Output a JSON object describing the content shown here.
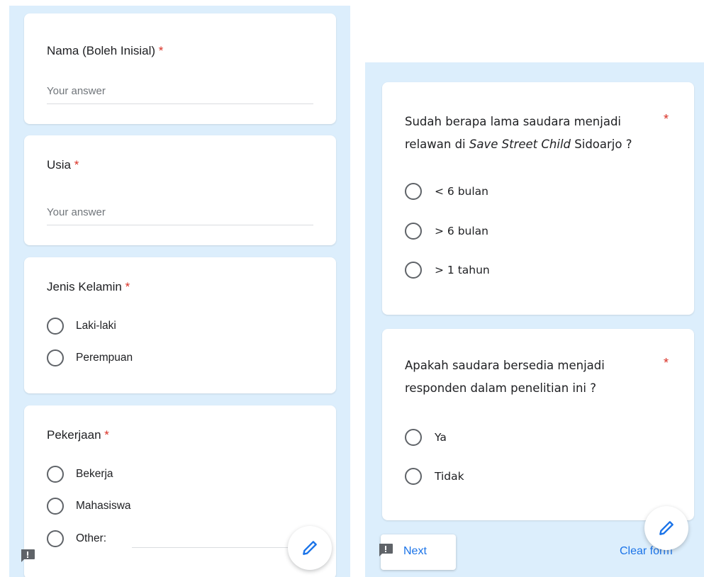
{
  "left_form": {
    "name_question": {
      "title": "Nama (Boleh Inisial)",
      "required_mark": "*",
      "placeholder": "Your answer"
    },
    "age_question": {
      "title": "Usia",
      "required_mark": "*",
      "placeholder": "Your answer"
    },
    "gender_question": {
      "title": "Jenis Kelamin",
      "required_mark": "*",
      "options": [
        "Laki-laki",
        "Perempuan"
      ]
    },
    "job_question": {
      "title": "Pekerjaan",
      "required_mark": "*",
      "options": [
        "Bekerja",
        "Mahasiswa",
        "Other:"
      ]
    }
  },
  "right_form": {
    "duration_question": {
      "title_line1": "Sudah berapa lama saudara menjadi",
      "title_line2_prefix": "relawan di ",
      "title_line2_italic": "Save Street Child",
      "title_line2_suffix": " Sidoarjo ?",
      "required_mark": "*",
      "options": [
        "< 6 bulan",
        "> 6 bulan",
        "> 1 tahun"
      ]
    },
    "consent_question": {
      "title_line1": "Apakah saudara bersedia menjadi",
      "title_line2": "responden dalam penelitian ini ?",
      "required_mark": "*",
      "options": [
        "Ya",
        "Tidak"
      ]
    },
    "footer": {
      "next_label": "Next",
      "clear_label": "Clear form"
    }
  },
  "icons": {
    "edit": "pencil-icon",
    "feedback": "feedback-icon"
  },
  "colors": {
    "background": "#dceefc",
    "required": "#d93025",
    "accent": "#1a73e8"
  }
}
